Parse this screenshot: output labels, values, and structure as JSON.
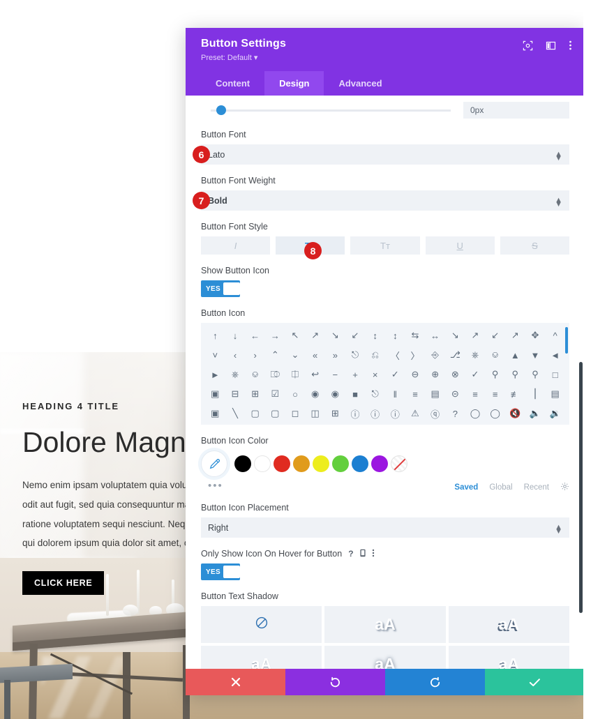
{
  "background": {
    "kicker": "HEADING 4 TITLE",
    "heading": "Dolore Magnam",
    "paragraph_lines": [
      "Nemo enim ipsam voluptatem quia voluptas si",
      "odit aut fugit, sed quia consequuntur magni d",
      "ratione voluptatem sequi nesciunt. Neque por",
      "qui dolorem ipsum quia dolor sit amet, consec"
    ],
    "button_label": "CLICK HERE"
  },
  "modal": {
    "title": "Button Settings",
    "preset": "Preset: Default",
    "header_icons": [
      "focus-target-icon",
      "layout-panel-icon",
      "more-vertical-icon"
    ],
    "tabs": [
      {
        "label": "Content",
        "active": false
      },
      {
        "label": "Design",
        "active": true
      },
      {
        "label": "Advanced",
        "active": false
      }
    ],
    "slider": {
      "value": "0px",
      "position_percent": 2
    },
    "fields": {
      "button_font": {
        "label": "Button Font",
        "value": "Lato",
        "badge": "6"
      },
      "button_font_weight": {
        "label": "Button Font Weight",
        "value": "Bold",
        "badge": "7"
      },
      "button_font_style": {
        "label": "Button Font Style",
        "badge": "8",
        "options": [
          {
            "name": "italic",
            "glyph": "I",
            "active": false
          },
          {
            "name": "uppercase",
            "glyph": "TT",
            "active": true
          },
          {
            "name": "small-caps",
            "glyph": "Tт",
            "active": false
          },
          {
            "name": "underline",
            "glyph": "U",
            "active": false
          },
          {
            "name": "strikethrough",
            "glyph": "S",
            "active": false
          }
        ]
      },
      "show_button_icon": {
        "label": "Show Button Icon",
        "toggle": "YES"
      },
      "button_icon": {
        "label": "Button Icon"
      },
      "button_icon_color": {
        "label": "Button Icon Color",
        "swatches": [
          "#000000",
          "#ffffff",
          "#e02b20",
          "#e09b1c",
          "#eded1e",
          "#63cf3d",
          "#1c7fd1",
          "#9b16e0",
          "none"
        ],
        "tabs": [
          {
            "label": "Saved",
            "active": true
          },
          {
            "label": "Global",
            "active": false
          },
          {
            "label": "Recent",
            "active": false
          }
        ]
      },
      "button_icon_placement": {
        "label": "Button Icon Placement",
        "value": "Right"
      },
      "only_show_icon_on_hover": {
        "label": "Only Show Icon On Hover for Button",
        "toggle": "YES",
        "mini_icons": [
          "help-icon",
          "mobile-icon",
          "more-vertical-icon"
        ]
      },
      "button_text_shadow": {
        "label": "Button Text Shadow",
        "cells": [
          {
            "name": "none",
            "glyph": "⊘",
            "active": true
          },
          {
            "name": "shadow-1",
            "glyph": "aA",
            "active": false
          },
          {
            "name": "shadow-2",
            "glyph": "aA",
            "active": false
          },
          {
            "name": "shadow-3",
            "glyph": "aA",
            "active": false
          },
          {
            "name": "shadow-4",
            "glyph": "aA",
            "active": false
          },
          {
            "name": "shadow-5",
            "glyph": "aA",
            "active": false
          }
        ]
      }
    },
    "footer": [
      {
        "name": "cancel-button",
        "icon": "x-icon"
      },
      {
        "name": "undo-button",
        "icon": "undo-icon"
      },
      {
        "name": "redo-button",
        "icon": "redo-icon"
      },
      {
        "name": "save-button",
        "icon": "check-icon"
      }
    ]
  },
  "colors": {
    "header_purple": "#8133e3",
    "tab_active": "#9148ee",
    "toggle_blue": "#2c8ed6",
    "badge_red": "#d81e1e",
    "footer_cancel": "#e8595a",
    "footer_undo": "#8b2fe0",
    "footer_redo": "#2383d4",
    "footer_save": "#2bc39c"
  }
}
